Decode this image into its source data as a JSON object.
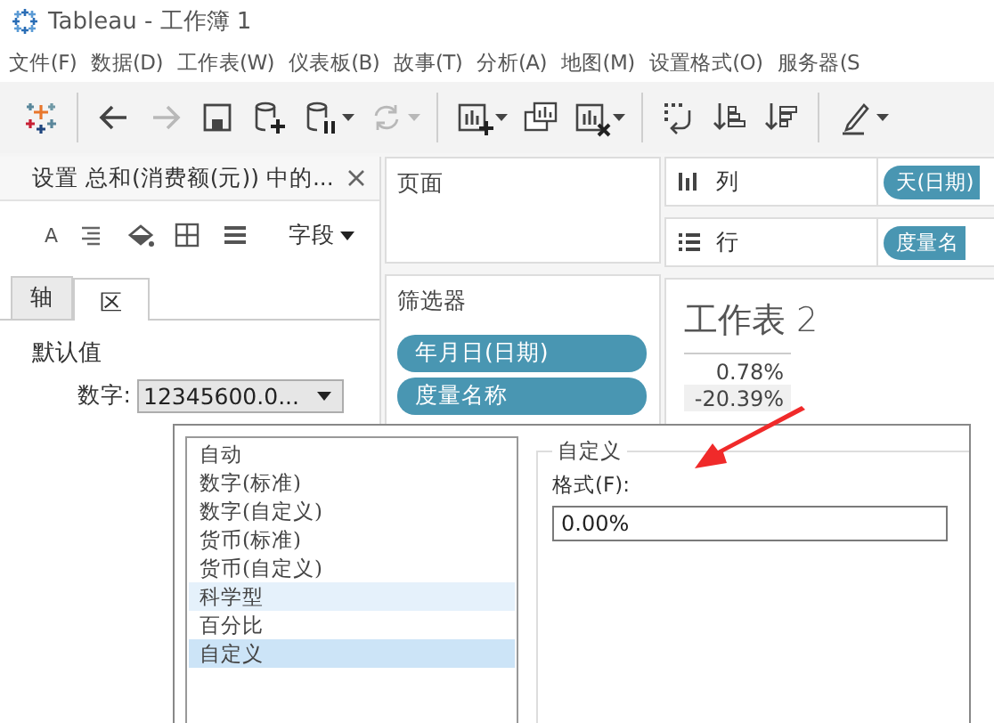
{
  "window": {
    "title": "Tableau - 工作簿 1"
  },
  "menu": [
    "文件(F)",
    "数据(D)",
    "工作表(W)",
    "仪表板(B)",
    "故事(T)",
    "分析(A)",
    "地图(M)",
    "设置格式(O)",
    "服务器(S"
  ],
  "toolbar": [
    {
      "kind": "logo",
      "disabled": false,
      "menu": false
    },
    {
      "kind": "separator"
    },
    {
      "kind": "back",
      "disabled": false,
      "menu": false
    },
    {
      "kind": "forward",
      "disabled": true,
      "menu": false
    },
    {
      "kind": "save",
      "disabled": false,
      "menu": false
    },
    {
      "kind": "add-data",
      "disabled": false,
      "menu": false
    },
    {
      "kind": "pause-data",
      "disabled": false,
      "menu": true
    },
    {
      "kind": "refresh",
      "disabled": true,
      "menu": true
    },
    {
      "kind": "separator"
    },
    {
      "kind": "new-sheet",
      "disabled": false,
      "menu": true
    },
    {
      "kind": "duplicate",
      "disabled": false,
      "menu": false
    },
    {
      "kind": "clear",
      "disabled": false,
      "menu": true
    },
    {
      "kind": "separator"
    },
    {
      "kind": "swap",
      "disabled": false,
      "menu": false
    },
    {
      "kind": "sort-asc",
      "disabled": false,
      "menu": false
    },
    {
      "kind": "sort-desc",
      "disabled": false,
      "menu": false
    },
    {
      "kind": "separator"
    },
    {
      "kind": "highlight",
      "disabled": false,
      "menu": true
    }
  ],
  "format_pane": {
    "title": "设置 总和(消费额(元)) 中的...",
    "tools": [
      {
        "kind": "font",
        "label": "A"
      },
      {
        "kind": "align"
      },
      {
        "kind": "shading"
      },
      {
        "kind": "borders"
      },
      {
        "kind": "lines"
      }
    ],
    "field_menu": "字段",
    "tabs": [
      {
        "label": "轴",
        "selected": false
      },
      {
        "label": "区",
        "selected": true
      }
    ],
    "section": "默认值",
    "number_label": "数字:",
    "number_value": "12345600.0..."
  },
  "pages_card": {
    "title": "页面"
  },
  "filters_card": {
    "title": "筛选器",
    "pills": [
      "年月日(日期)",
      "度量名称"
    ]
  },
  "shelves": [
    {
      "kind": "columns",
      "label": "列",
      "pills": [
        "天(日期)"
      ]
    },
    {
      "kind": "rows",
      "label": "行",
      "pills": [
        "度量名"
      ]
    }
  ],
  "view": {
    "title": "工作表 2",
    "values": [
      "0.78%",
      "-20.39%"
    ]
  },
  "format_popup": {
    "types": [
      {
        "label": "自动",
        "selected": false,
        "hovered": false
      },
      {
        "label": "数字(标准)",
        "selected": false,
        "hovered": false
      },
      {
        "label": "数字(自定义)",
        "selected": false,
        "hovered": false
      },
      {
        "label": "货币(标准)",
        "selected": false,
        "hovered": false
      },
      {
        "label": "货币(自定义)",
        "selected": false,
        "hovered": false
      },
      {
        "label": "科学型",
        "selected": false,
        "hovered": true
      },
      {
        "label": "百分比",
        "selected": false,
        "hovered": false
      },
      {
        "label": "自定义",
        "selected": true,
        "hovered": false
      }
    ],
    "group": "自定义",
    "format_label": "格式(F):",
    "format_value": "0.00%"
  }
}
